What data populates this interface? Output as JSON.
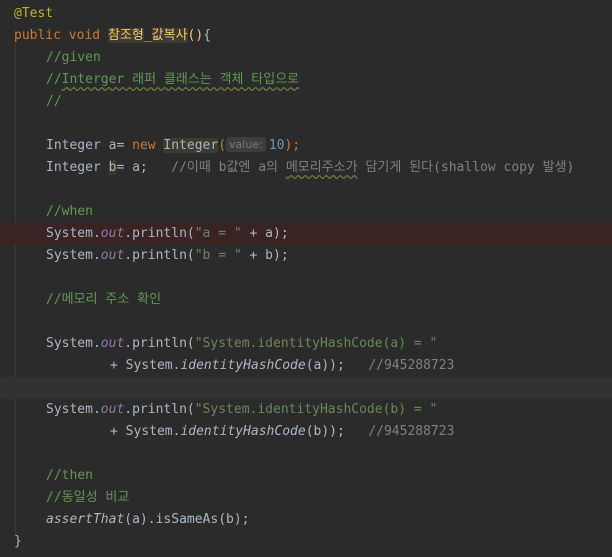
{
  "editor": {
    "annotation": "@Test",
    "signature": {
      "public_kw": "public",
      "void_kw": "void",
      "method_name_a": "참조형",
      "method_name_sep": "_",
      "method_name_b": "값복사",
      "parens": "()",
      "brace_open": "{"
    },
    "comment_given": "//given",
    "comment_integer": {
      "slashes": "//",
      "word": "Interger",
      "rest": " 래퍼 클래스는 객체 타입으로"
    },
    "comment_empty": "//",
    "decl_a": {
      "type": "Integer",
      "var": " a= ",
      "new_kw": "new",
      "ctor": "Integer",
      "paren": "(",
      "hint_label": "value:",
      "value": "10",
      "end": ");"
    },
    "decl_b": {
      "type": "Integer",
      "var": "b",
      "rest": "= a;",
      "comment_prefix": "//이때 b값엔 a의 ",
      "comment_word": "메모리주소가",
      "comment_rest": " 담기게 된다(shallow copy 발생)"
    },
    "comment_when": "//when",
    "println_a": {
      "system": "System.",
      "out": "out",
      "println": ".println(",
      "str": "\"a = \"",
      "rest": " + a);"
    },
    "println_b": {
      "system": "System.",
      "out": "out",
      "println": ".println(",
      "str": "\"b = \"",
      "rest": " + b);"
    },
    "comment_memory": "//메모리 주소 확인",
    "hash_a": {
      "system": "System.",
      "out": "out",
      "println": ".println(",
      "str": "\"System.identityHashCode(a) = \"",
      "cont_plus": "+ System.",
      "cont_call": "identityHashCode",
      "cont_rest": "(a));",
      "cont_comment": "//945288723"
    },
    "hash_b": {
      "system": "System.",
      "out": "out",
      "println": ".println(",
      "str": "\"System.identityHashCode(b) = \"",
      "cont_plus": "+ System.",
      "cont_call": "identityHashCode",
      "cont_rest": "(b));",
      "cont_comment": "//945288723"
    },
    "comment_then": "//then",
    "comment_identity": "//동일성 비교",
    "assert": {
      "call": "assertThat",
      "rest": "(a).isSameAs(b);"
    },
    "brace_close": "}"
  },
  "colors": {
    "background": "#2b2b2b",
    "keyword": "#cc7832",
    "annotation": "#bbb529",
    "string": "#6a8759",
    "number": "#6897bb",
    "comment": "#808080",
    "static_field": "#9876aa",
    "breakpoint_line": "#3a2323"
  }
}
